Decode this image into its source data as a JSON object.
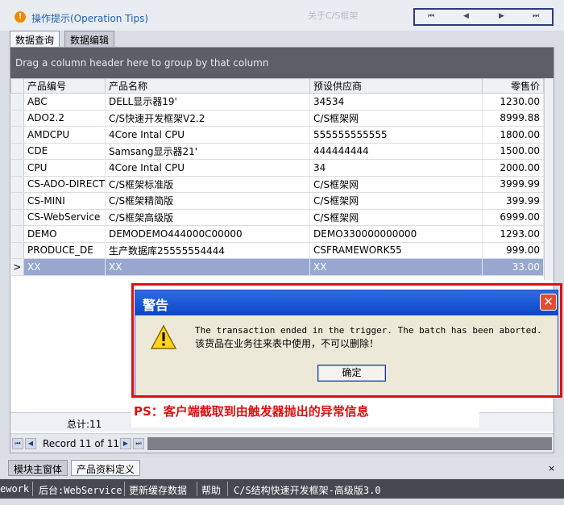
{
  "header": {
    "tips_icon": "info-icon",
    "tips_text": "操作提示(Operation Tips)",
    "faded_title": "关于C/S框架",
    "nav_buttons": [
      "⏮",
      "◀",
      "▶",
      "⏭"
    ]
  },
  "tabs": [
    {
      "label": "数据查询",
      "active": true
    },
    {
      "label": "数据编辑",
      "active": false
    }
  ],
  "grid": {
    "group_hint": "Drag a column header here to group by that column",
    "columns": [
      "产品编号",
      "产品名称",
      "预设供应商",
      "零售价"
    ],
    "rows": [
      {
        "code": "ABC",
        "name": "DELL显示器19'",
        "supplier": "34534",
        "price": "1230.00"
      },
      {
        "code": "ADO2.2",
        "name": "C/S快速开发框架V2.2",
        "supplier": "C/S框架网",
        "price": "8999.88"
      },
      {
        "code": "AMDCPU",
        "name": "4Core Intal CPU",
        "supplier": "555555555555",
        "price": "1800.00"
      },
      {
        "code": "CDE",
        "name": "Samsang显示器21'",
        "supplier": "444444444",
        "price": "1500.00"
      },
      {
        "code": "CPU",
        "name": "4Core Intal CPU",
        "supplier": "34",
        "price": "2000.00"
      },
      {
        "code": "CS-ADO-DIRECT",
        "name": "C/S框架标准版",
        "supplier": "C/S框架网",
        "price": "3999.99"
      },
      {
        "code": "CS-MINI",
        "name": "C/S框架精简版",
        "supplier": "C/S框架网",
        "price": "399.99"
      },
      {
        "code": "CS-WebService",
        "name": "C/S框架高级版",
        "supplier": "C/S框架网",
        "price": "6999.00"
      },
      {
        "code": "DEMO",
        "name": "DEMODEMO444000C00000",
        "supplier": "DEMO330000000000",
        "price": "1293.00"
      },
      {
        "code": "PRODUCE_DE",
        "name": "生产数据库25555554444",
        "supplier": "CSFRAMEWORK55",
        "price": "999.00"
      },
      {
        "code": "XX",
        "name": "XX",
        "supplier": "XX",
        "price": "33.00"
      }
    ],
    "selected_indicator": ">",
    "total": "总计:11",
    "record_text": "Record 11 of 11"
  },
  "bottom_tabs": [
    {
      "label": "模块主窗体",
      "active": false
    },
    {
      "label": "产品资料定义",
      "active": true
    }
  ],
  "bottom_close": "×",
  "statusbar": {
    "items": [
      "ework",
      "后台:WebService",
      "更新缓存数据",
      "帮助",
      "C/S结构快速开发框架-高级版3.0"
    ]
  },
  "dialog": {
    "title": "警告",
    "close_label": "✕",
    "icon": "warning-icon",
    "message_line1": "The transaction ended in the trigger. The batch has been aborted.",
    "message_line2": "该货品在业务往来表中使用，不可以删除！",
    "ok_label": "确定"
  },
  "annotation": {
    "text": "PS：客户端截取到由触发器抛出的异常信息",
    "color": "#e00f0f"
  }
}
